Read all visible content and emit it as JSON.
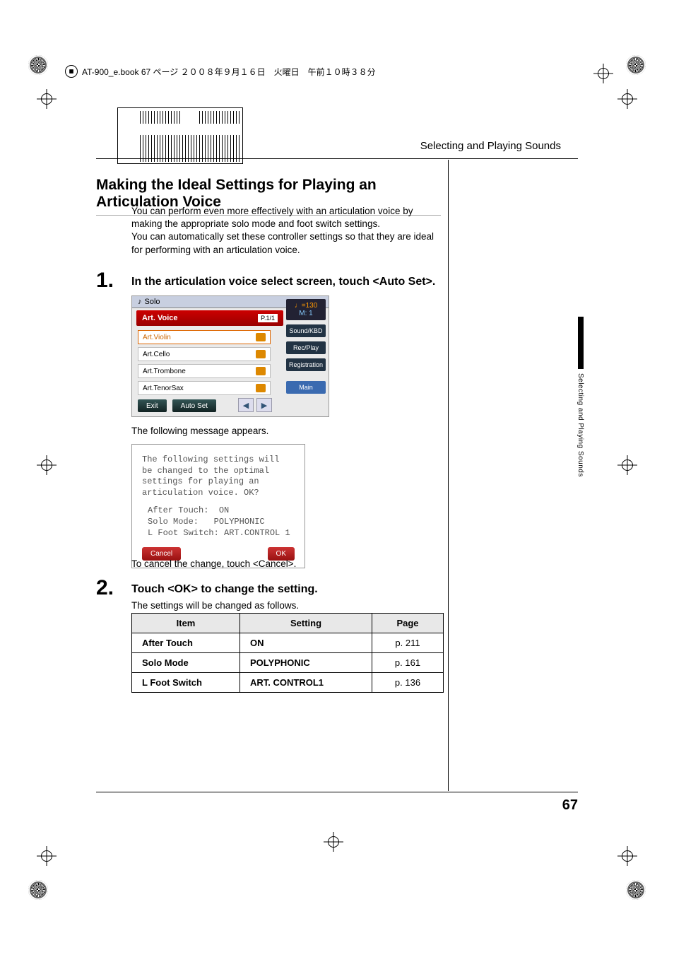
{
  "meta": {
    "file_header": "AT-900_e.book  67 ページ  ２００８年９月１６日　火曜日　午前１０時３８分"
  },
  "running_head": "Selecting and Playing Sounds",
  "section_title": "Making the Ideal Settings for Playing an Articulation Voice",
  "intro": "You can perform even more effectively with an articulation voice by making the appropriate solo mode and foot switch settings.\nYou can automatically set these controller settings so that they are ideal for performing with an articulation voice.",
  "step1": {
    "num": "1.",
    "head": "In the articulation voice select screen, touch <Auto Set>."
  },
  "screenshot1": {
    "title": "Solo",
    "tab": "Art. Voice",
    "page_pill": "P.1/1",
    "items": [
      "Art.Violin",
      "Art.Cello",
      "Art.Trombone",
      "Art.TenorSax"
    ],
    "exit": "Exit",
    "auto_set": "Auto Set",
    "prev": "◀",
    "next": "▶",
    "tempo_top": "♩=130",
    "tempo_bottom": "M:    1",
    "side": [
      "Sound/KBD",
      "Rec/Play",
      "Registration",
      "Main"
    ]
  },
  "caption1": "The following message appears.",
  "dialog": {
    "msg": "The following settings will be changed to the optimal settings for playing an articulation voice. OK?",
    "k1": "After Touch:",
    "v1": "ON",
    "k2": "Solo Mode:",
    "v2": "POLYPHONIC",
    "k3": "L Foot Switch:",
    "v3": "ART.CONTROL 1",
    "cancel": "Cancel",
    "ok": "OK"
  },
  "caption2": "To cancel the change, touch <Cancel>.",
  "step2": {
    "num": "2.",
    "head": "Touch <OK> to change the setting.",
    "sub": "The settings will be changed as follows."
  },
  "table": {
    "headers": [
      "Item",
      "Setting",
      "Page"
    ],
    "rows": [
      {
        "item": "After Touch",
        "setting": "ON",
        "page": "p. 211"
      },
      {
        "item": "Solo Mode",
        "setting": "POLYPHONIC",
        "page": "p. 161"
      },
      {
        "item": "L Foot Switch",
        "setting": "ART. CONTROL1",
        "page": "p. 136"
      }
    ]
  },
  "side_text": "Selecting and Playing Sounds",
  "page_number": "67"
}
